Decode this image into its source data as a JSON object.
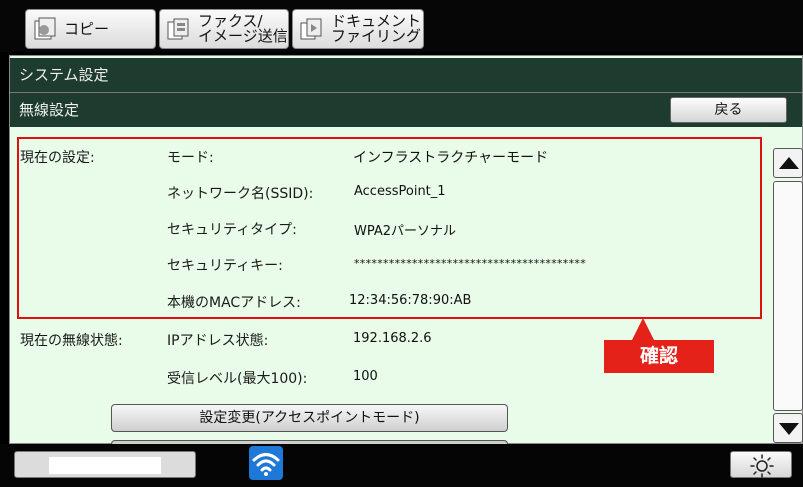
{
  "tabs": [
    {
      "label": "コピー",
      "icon": "copy-icon"
    },
    {
      "label": "ファクス/\nイメージ送信",
      "icon": "fax-image-send-icon"
    },
    {
      "label": "ドキュメント\nファイリング",
      "icon": "document-filing-icon"
    }
  ],
  "header": {
    "system_settings": "システム設定",
    "wireless_settings": "無線設定",
    "back_label": "戻る"
  },
  "current_settings": {
    "section_label": "現在の設定:",
    "rows": [
      {
        "label": "モード:",
        "value": "インフラストラクチャーモード"
      },
      {
        "label": "ネットワーク名(SSID):",
        "value": "AccessPoint_1"
      },
      {
        "label": "セキュリティタイプ:",
        "value": "WPA2パーソナル"
      },
      {
        "label": "セキュリティキー:",
        "value": "****************************************"
      },
      {
        "label": "本機のMACアドレス:",
        "value": "12:34:56:78:90:AB"
      }
    ]
  },
  "wireless_status": {
    "section_label": "現在の無線状態:",
    "rows": [
      {
        "label": "IPアドレス状態:",
        "value": "192.168.2.6"
      },
      {
        "label": "受信レベル(最大100):",
        "value": "100"
      }
    ]
  },
  "callout_label": "確認",
  "change_button_label": "設定変更(アクセスポイントモード)",
  "icons": {
    "wifi": "wifi-icon",
    "brightness": "brightness-icon"
  },
  "colors": {
    "header_bar": "#1d3b2f",
    "panel_bg": "#e9fbe9",
    "highlight": "#e01010",
    "callout": "#e52219",
    "wifi_tile": "#1e78d8"
  }
}
